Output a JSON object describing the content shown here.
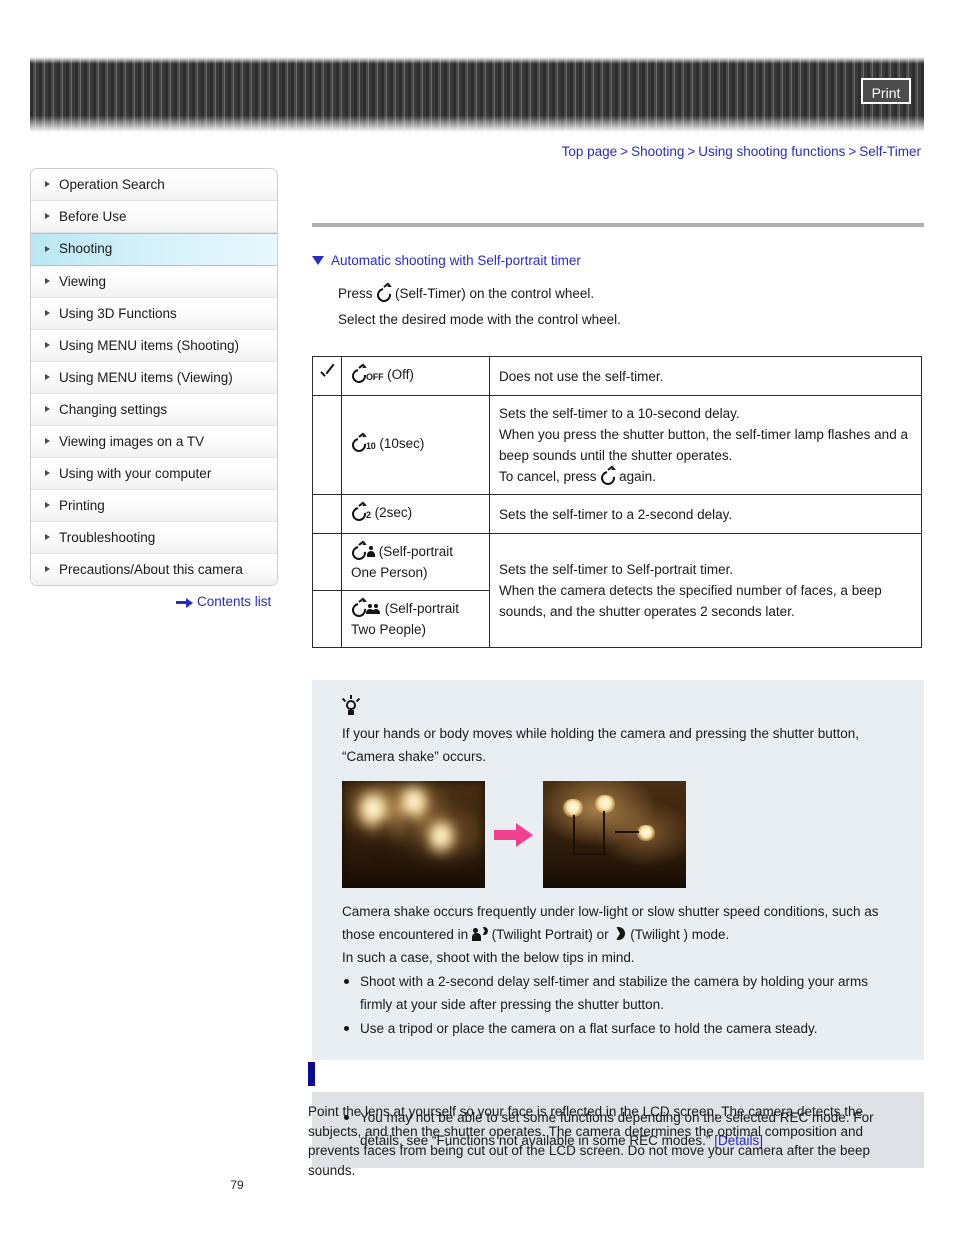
{
  "header": {
    "print_label": "Print"
  },
  "breadcrumb": {
    "items": [
      "Top page",
      "Shooting",
      "Using shooting functions",
      "Self-Timer"
    ],
    "separator": ">"
  },
  "sidebar": {
    "items": [
      {
        "label": "Operation Search",
        "active": false
      },
      {
        "label": "Before Use",
        "active": false
      },
      {
        "label": "Shooting",
        "active": true
      },
      {
        "label": "Viewing",
        "active": false
      },
      {
        "label": "Using 3D Functions",
        "active": false
      },
      {
        "label": "Using MENU items (Shooting)",
        "active": false
      },
      {
        "label": "Using MENU items (Viewing)",
        "active": false
      },
      {
        "label": "Changing settings",
        "active": false
      },
      {
        "label": "Viewing images on a TV",
        "active": false
      },
      {
        "label": "Using with your computer",
        "active": false
      },
      {
        "label": "Printing",
        "active": false
      },
      {
        "label": "Troubleshooting",
        "active": false
      },
      {
        "label": "Precautions/About this camera",
        "active": false
      }
    ],
    "contents_list_label": "Contents list"
  },
  "main": {
    "section_heading": "Automatic shooting with Self-portrait timer",
    "step_1_prefix": "Press",
    "step_1_suffix": "(Self-Timer) on the control wheel.",
    "step_2": "Select the desired mode with the control wheel.",
    "table": {
      "rows": [
        {
          "checked": true,
          "mode_sub": "OFF",
          "mode_label": "(Off)",
          "desc": "Does not use the self-timer."
        },
        {
          "checked": false,
          "mode_sub": "10",
          "mode_label": "(10sec)",
          "desc_line_1": "Sets the self-timer to a 10-second delay.",
          "desc_line_2": "When you press the shutter button, the self-timer lamp flashes and a beep sounds until the shutter operates.",
          "desc_line_3_prefix": "To cancel, press",
          "desc_line_3_suffix": "again."
        },
        {
          "checked": false,
          "mode_sub": "2",
          "mode_label": "(2sec)",
          "desc": "Sets the self-timer to a 2-second delay."
        },
        {
          "checked": false,
          "mode_sub": "",
          "mode_label": "(Self-portrait One Person)",
          "desc": ""
        },
        {
          "checked": false,
          "mode_sub": "",
          "mode_label": "(Self-portrait Two People)",
          "desc": ""
        }
      ],
      "selfportrait_desc_line_1": "Sets the self-timer to Self-portrait timer.",
      "selfportrait_desc_line_2": "When the camera detects the specified number of faces, a beep sounds, and the shutter operates 2 seconds later."
    },
    "tip_box": {
      "intro": "If your hands or body moves while holding the camera and pressing the shutter button, “Camera shake” occurs.",
      "after_images_1_part_1": "Camera shake occurs frequently under low-light or slow shutter speed conditions, such as those encountered in",
      "after_images_1_part_2": "(Twilight Portrait) or",
      "after_images_1_part_3": "(Twilight ) mode.",
      "after_images_2": "In such a case, shoot with the below tips in mind.",
      "bullets": [
        "Shoot with a 2-second delay self-timer and stabilize the camera by holding your arms firmly at your side after pressing the shutter button.",
        "Use a tripod or place the camera on a flat surface to hold the camera steady."
      ]
    },
    "note_box": {
      "bullet_text": "You may not be able to set some functions depending on the selected REC mode. For details, see “Functions not available in some REC modes.”",
      "details_link": "[Details]"
    },
    "bottom_paragraph": "Point the lens at yourself so your face is reflected in the LCD screen. The camera detects the subjects, and then the shutter operates. The camera determines the optimal composition and prevents faces from being cut out of the LCD screen. Do not move your camera after the beep sounds."
  },
  "footer": {
    "page_number": "79"
  },
  "colors": {
    "link": "#2b2bc0",
    "active_nav": "#b9e7f4",
    "tip_bg": "#e9eef3",
    "note_bg": "#dee1e6",
    "arrow_pink": "#f0418f",
    "marker_blue": "#0a0a96"
  }
}
